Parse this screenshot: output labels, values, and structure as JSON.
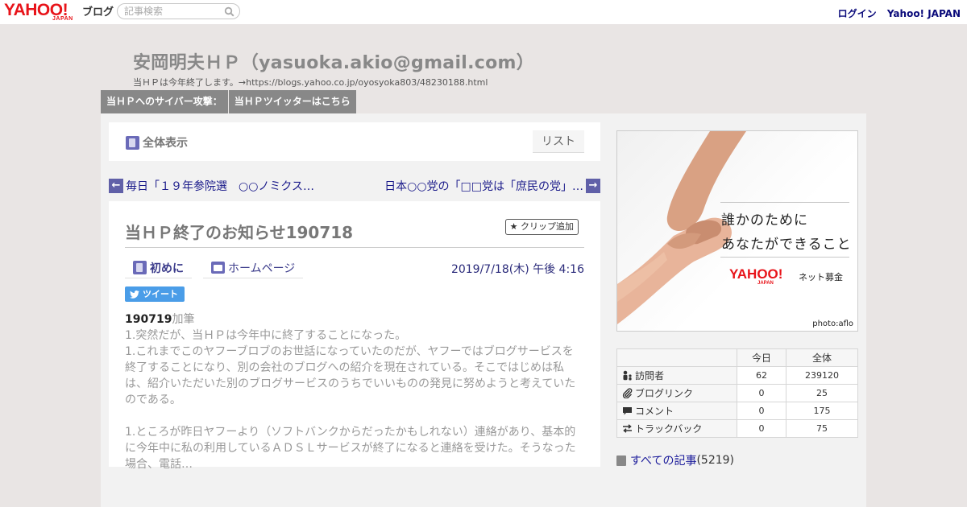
{
  "topbar": {
    "logo_text": "YAHOO!",
    "logo_sub": "JAPAN",
    "service_label": "ブログ",
    "search_placeholder": "記事検索",
    "login_label": "ログイン",
    "yahoo_japan_label": "Yahoo! JAPAN"
  },
  "blog": {
    "title": "安岡明夫ＨＰ（yasuoka.akio@gmail.com）",
    "description": "当ＨＰは今年終了します。→https://blogs.yahoo.co.jp/oyosyoka803/48230188.html"
  },
  "menu": [
    {
      "label": "当ＨＰへのサイバー攻撃："
    },
    {
      "label": "当ＨＰツイッターはこちら"
    }
  ],
  "viewbar": {
    "show_all_label": "全体表示",
    "list_label": "リスト"
  },
  "pager": {
    "prev_title": "毎日「１９年参院選　○○ノミクス…",
    "next_title": "日本○○党の「□□党は「庶民の党」…"
  },
  "article": {
    "title": "当ＨＰ終了のお知らせ190718",
    "clip_label": "クリップ追加",
    "category_primary": "初めに",
    "category_secondary": "ホームページ",
    "date": "2019/7/18(木) 午後 4:16",
    "tweet_label": "ツイート",
    "body": {
      "lead_bold": "190719",
      "lead_rest": "加筆",
      "p1": "1.突然だが、当ＨＰは今年中に終了することになった。",
      "p2": "1.これまでこのヤフーブロブのお世話になっていたのだが、ヤフーではブログサービスを終了することになり、別の会社のブログへの紹介を現在されている。そこではじめは私は、紹介いただいた別のブログサービスのうちでいいものの発見に努めようと考えていたのである。",
      "p3": "1.ところが昨日ヤフーより（ソフトバンクからだったかもしれない）連絡があり、基本的に今年中に私の利用しているＡＤＳＬサービスが終了になると連絡を受けた。そうなった場合、電話…"
    }
  },
  "ad": {
    "headline_line1": "誰かのために",
    "headline_line2": "あなたができること",
    "logo_text": "YAHOO!",
    "logo_sub": "JAPAN",
    "brand_label": "ネット募金",
    "credit": "photo:aflo"
  },
  "stats": {
    "col_today": "今日",
    "col_total": "全体",
    "rows": [
      {
        "label": "訪問者",
        "icon": "visitors-icon",
        "today": "62",
        "total": "239120"
      },
      {
        "label": "ブログリンク",
        "icon": "paperclip-icon",
        "today": "0",
        "total": "25"
      },
      {
        "label": "コメント",
        "icon": "comment-icon",
        "today": "0",
        "total": "175"
      },
      {
        "label": "トラックバック",
        "icon": "trackback-icon",
        "today": "0",
        "total": "75"
      }
    ]
  },
  "all_posts": {
    "label": "すべての記事",
    "count": "(5219)"
  }
}
